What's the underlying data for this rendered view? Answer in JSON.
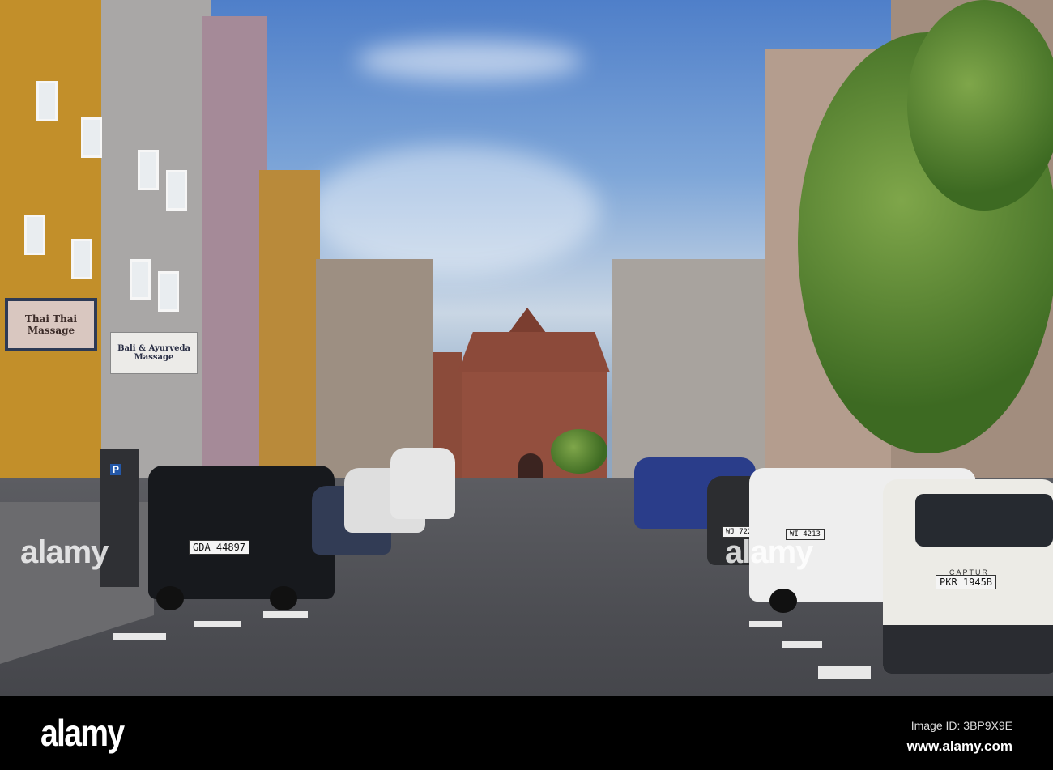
{
  "watermark": {
    "logo": "alamy",
    "image_id": "Image ID: 3BP9X9E",
    "url": "www.alamy.com",
    "overlay": "alamy"
  },
  "signs": {
    "thai_massage": "Thai Thai Massage",
    "bali_massage": "Bali & Ayurveda Massage",
    "parking": "P"
  },
  "plates": {
    "citroen": "GDA 44897",
    "renault": "PKR 1945B",
    "acura": "WI 4213",
    "dark_car": "WJ 7220N"
  },
  "car_badges": {
    "renault_model": "CAPTUR"
  },
  "colors": {
    "sky": "#6f9bd6",
    "yellow_facade": "#c9962a",
    "brick_gate": "#8a4634",
    "road": "#55565b"
  }
}
